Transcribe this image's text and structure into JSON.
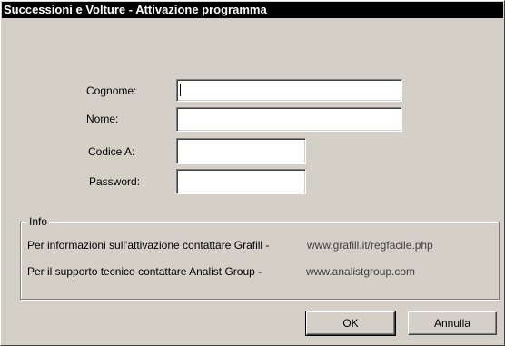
{
  "window": {
    "title": "Successioni e Volture - Attivazione programma"
  },
  "form": {
    "cognome_label": "Cognome:",
    "cognome_value": "",
    "nome_label": "Nome:",
    "nome_value": "",
    "codice_label": "Codice A:",
    "codice_value": "",
    "password_label": "Password:",
    "password_value": ""
  },
  "info": {
    "legend": "Info",
    "line1_text": "Per informazioni sull'attivazione contattare Grafill -",
    "line1_url": "www.grafill.it/regfacile.php",
    "line2_text": "Per il supporto tecnico contattare Analist Group -",
    "line2_url": "www.analistgroup.com"
  },
  "buttons": {
    "ok": "OK",
    "cancel": "Annulla"
  },
  "colors": {
    "face": "#d4d0c8",
    "title_bg": "#000000",
    "title_fg": "#ffffff"
  }
}
